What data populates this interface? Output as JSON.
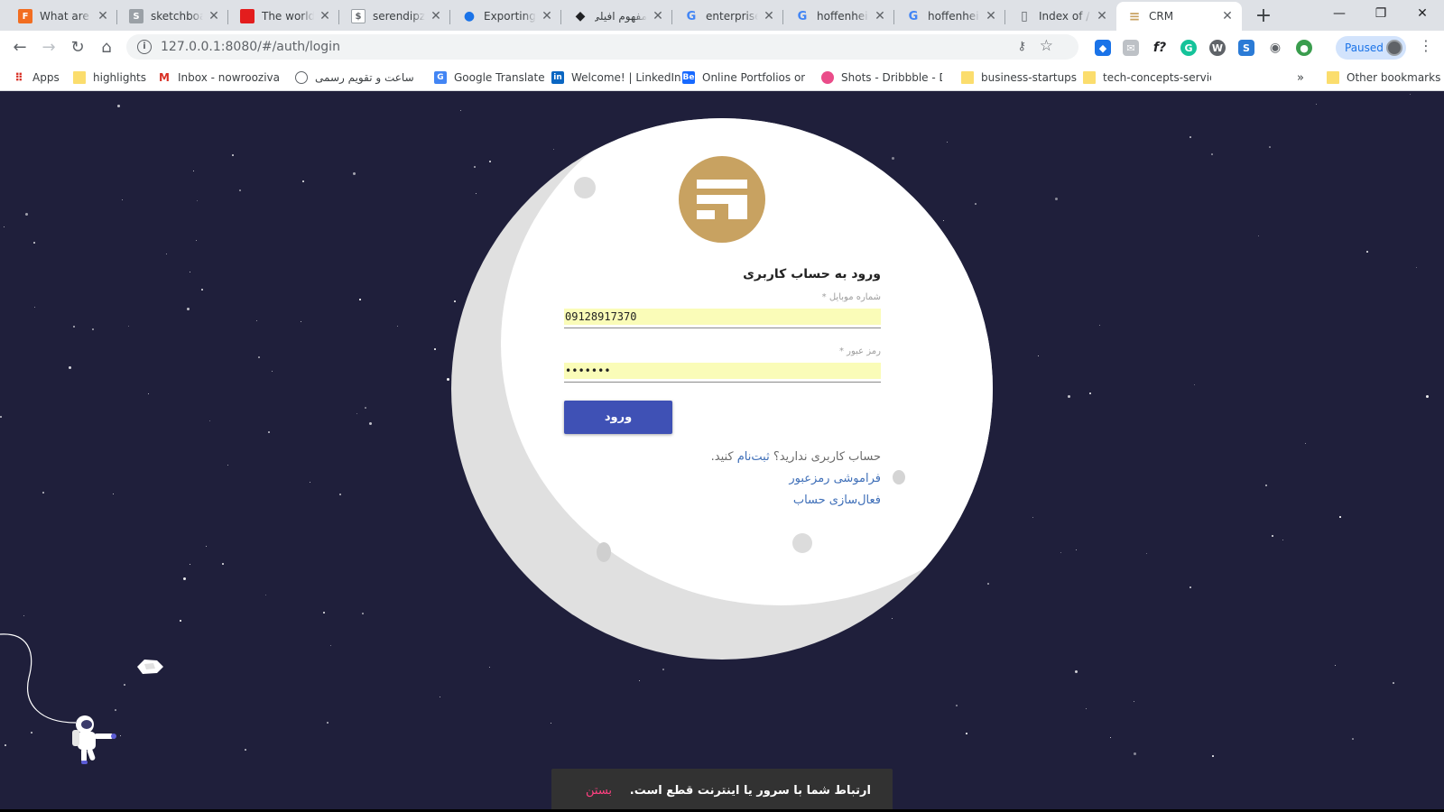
{
  "browser": {
    "tabs": [
      {
        "title": "What are Ex",
        "favicon": "F",
        "favicon_color": "#f26d21"
      },
      {
        "title": "sketchboard",
        "favicon": "S",
        "favicon_color": "#9aa0a6"
      },
      {
        "title": "The world's",
        "favicon": "",
        "favicon_color": "#e31d1d"
      },
      {
        "title": "serendipz.co",
        "favicon": "$",
        "favicon_color": "#5f6368"
      },
      {
        "title": "Exporting t",
        "favicon": "●",
        "favicon_color": "#1a73e8"
      },
      {
        "title": "مفهوم افیلی",
        "favicon": "◆",
        "favicon_color": "#202124"
      },
      {
        "title": "enterprise c",
        "favicon": "G",
        "favicon_color": "#4285f4"
      },
      {
        "title": "hoffenheim",
        "favicon": "G",
        "favicon_color": "#4285f4"
      },
      {
        "title": "hoffenheim",
        "favicon": "G",
        "favicon_color": "#4285f4"
      },
      {
        "title": "Index of /",
        "favicon": "▯",
        "favicon_color": "#9aa0a6"
      },
      {
        "title": "CRM",
        "favicon": "≡",
        "favicon_color": "#c8a261"
      }
    ],
    "active_tab": 10,
    "url": "127.0.0.1:8080/#/auth/login",
    "profile_status": "Paused",
    "bookmarks": [
      {
        "label": "Apps",
        "icon": "apps-grid-icon"
      },
      {
        "label": "highlights",
        "icon": "folder-icon"
      },
      {
        "label": "Inbox - nowroozivahi",
        "icon": "gmail-icon"
      },
      {
        "label": "ساعت و تقویم رسمی",
        "icon": "clock-icon"
      },
      {
        "label": "Google Translate",
        "icon": "translate-icon"
      },
      {
        "label": "Welcome! | LinkedIn",
        "icon": "linkedin-icon"
      },
      {
        "label": "Online Portfolios on B",
        "icon": "behance-icon"
      },
      {
        "label": "Shots - Dribbble - Dr",
        "icon": "dribbble-icon"
      },
      {
        "label": "business-startups",
        "icon": "folder-icon"
      },
      {
        "label": "tech-concepts-service",
        "icon": "folder-icon"
      }
    ],
    "other_bookmarks": "Other bookmarks",
    "overflow": "»"
  },
  "login": {
    "title": "ورود به حساب کاربری",
    "mobile_label": "شماره موبایل *",
    "mobile_value": "09128917370",
    "password_label": "رمز عبور *",
    "password_value": "•••••••",
    "submit_label": "ورود",
    "no_account_text": "حساب کاربری ندارید؟",
    "signup_link": "ثبت‌نام",
    "signup_suffix": "کنید.",
    "forgot_link": "فراموشی رمزعبور",
    "activate_link": "فعال‌سازی حساب"
  },
  "snackbar": {
    "message": "ارتباط شما با سرور یا اینترنت قطع است.",
    "action": "بستن"
  },
  "colors": {
    "background": "#1f1f3b",
    "logo": "#c8a261",
    "button": "#3f51b5",
    "autofill": "#fafcb8",
    "snack_action": "#ff4081"
  }
}
